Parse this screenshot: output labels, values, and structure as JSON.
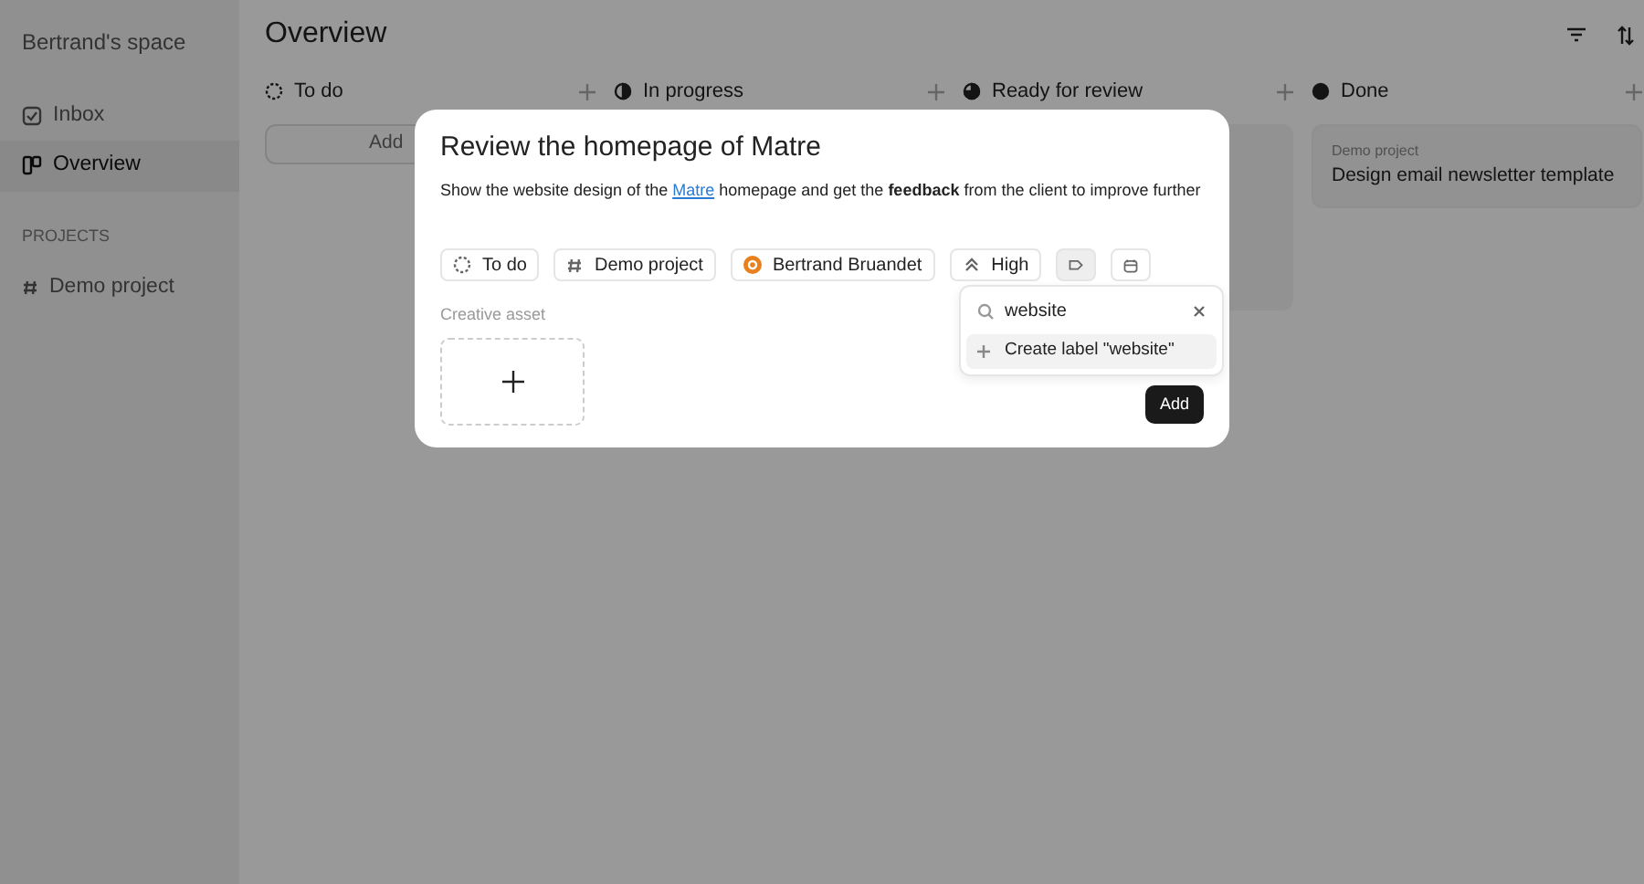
{
  "sidebar": {
    "workspace": "Bertrand's space",
    "items": [
      {
        "kind": "inbox",
        "label": "Inbox",
        "selected": false
      },
      {
        "kind": "board",
        "label": "Overview",
        "selected": true
      }
    ],
    "section_title": "PROJECTS",
    "projects": [
      {
        "label": "Demo project"
      }
    ]
  },
  "header": {
    "title": "Overview"
  },
  "columns": [
    {
      "kind": "todo",
      "title": "To do",
      "add_button": "Add"
    },
    {
      "kind": "progress",
      "title": "In progress"
    },
    {
      "kind": "review",
      "title": "Ready for review",
      "cards": [
        {
          "kind": "image"
        }
      ]
    },
    {
      "kind": "done",
      "title": "Done",
      "cards": [
        {
          "kind": "text",
          "project": "Demo project",
          "title": "Design email newsletter template"
        }
      ]
    }
  ],
  "modal": {
    "title": "Review the homepage of Matre",
    "description_before": "Show the website design of the ",
    "description_link": "Matre",
    "description_after": " homepage and get the **feedback** from the client to improve further",
    "chips": [
      {
        "kind": "status",
        "label": "To do",
        "selected": false
      },
      {
        "kind": "project",
        "label": "Demo project",
        "selected": false
      },
      {
        "kind": "assignee",
        "label": "Bertrand Bruandet",
        "selected": false
      },
      {
        "kind": "priority",
        "label": "High",
        "selected": false
      },
      {
        "kind": "label",
        "selected": true
      },
      {
        "kind": "date",
        "selected": false
      }
    ],
    "popover": {
      "search_value": "website",
      "option": "Create label \"website\""
    },
    "asset_label": "Creative asset",
    "add_button": "Add"
  }
}
